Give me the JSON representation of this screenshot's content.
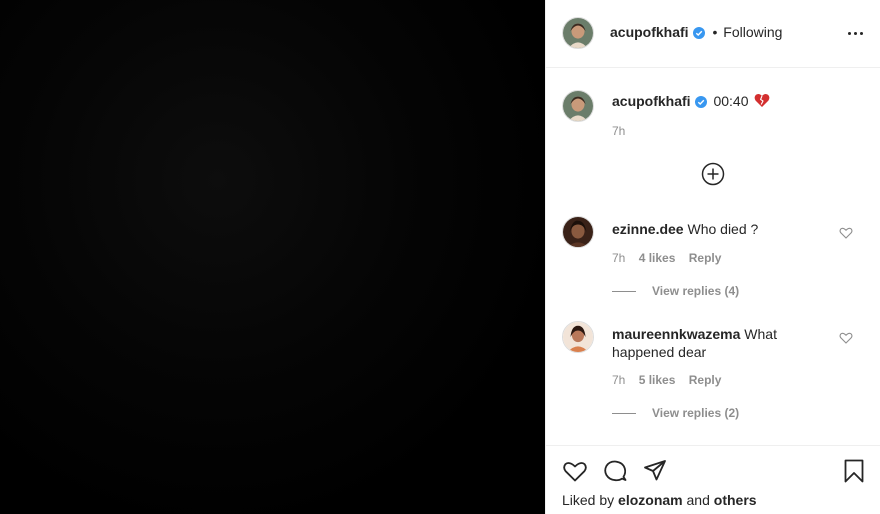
{
  "post": {
    "author": "acupofkhafi",
    "follow_status": "Following",
    "separator": "•",
    "caption_text": "00:40",
    "caption_time": "7h"
  },
  "comments": [
    {
      "username": "ezinne.dee",
      "text": "Who died ?",
      "time": "7h",
      "likes": "4 likes",
      "reply": "Reply",
      "view_replies": "View replies (4)"
    },
    {
      "username": "maureennkwazema",
      "text": "What happened dear",
      "time": "7h",
      "likes": "5 likes",
      "reply": "Reply",
      "view_replies": "View replies (2)"
    }
  ],
  "footer": {
    "liked_prefix": "Liked by",
    "liked_user": "elozonam",
    "liked_and": "and",
    "liked_others": "others"
  },
  "icons": {
    "verified": "verified-badge-icon",
    "more": "more-options-icon",
    "add": "plus-circle-icon",
    "like": "heart-icon",
    "comment": "comment-icon",
    "share": "send-icon",
    "save": "bookmark-icon"
  },
  "colors": {
    "verified_blue": "#3897f0",
    "text": "#262626",
    "muted": "#8e8e8e",
    "broken_heart": "#d32f2f"
  }
}
